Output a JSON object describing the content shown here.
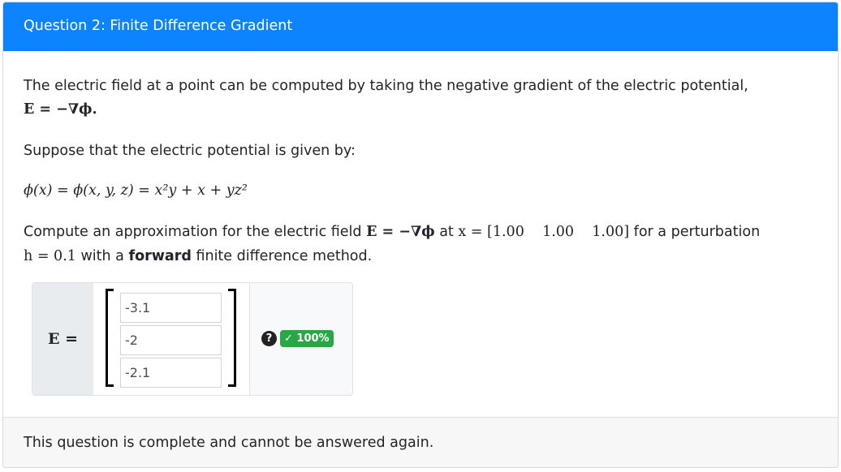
{
  "header": {
    "title": "Question 2: Finite Difference Gradient"
  },
  "body": {
    "p1_text": "The electric field at a point can be computed by taking the negative gradient of the electric potential,",
    "p1_math": "E = −∇ϕ.",
    "p2": "Suppose that the electric potential is given by:",
    "formula": "ϕ(x) = ϕ(x, y, z) = x²y + x + yz²",
    "p3_a": "Compute an approximation for the electric field",
    "p3_math1": "E = −∇ϕ",
    "p3_at": "at",
    "p3_math2": "x = [1.00    1.00    1.00]",
    "p3_b": "for a perturbation",
    "p4_math": "h = 0.1",
    "p4_a": "with a",
    "p4_bold": "forward",
    "p4_b": "finite difference method."
  },
  "answer": {
    "label": "E =",
    "values": [
      "-3.1",
      "-2",
      "-2.1"
    ],
    "help_icon": "question-circle-icon",
    "score_badge": "✓ 100%"
  },
  "footer": {
    "text": "This question is complete and cannot be answered again."
  },
  "colors": {
    "header_bg": "#0d84fd",
    "badge_green": "#28a745"
  }
}
